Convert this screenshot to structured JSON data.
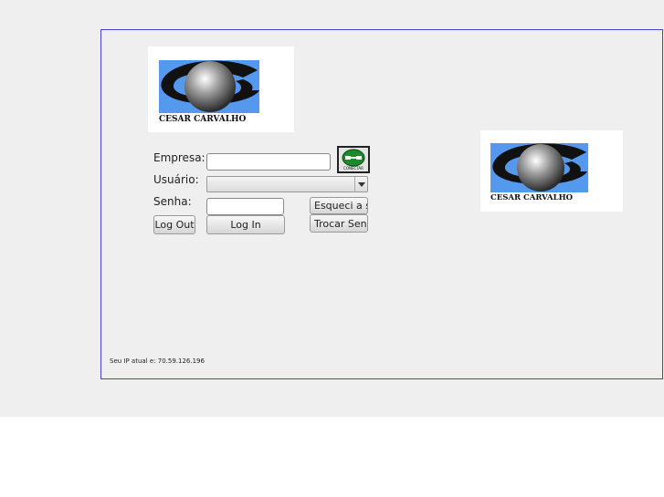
{
  "brand": {
    "name": "CESAR CARVALHO"
  },
  "form": {
    "empresa_label": "Empresa:",
    "usuario_label": "Usuário:",
    "senha_label": "Senha:",
    "empresa_value": "",
    "senha_value": "",
    "usuario_selected": "",
    "conectar_label": "CONECTAR"
  },
  "buttons": {
    "logout": "Log Out",
    "login": "Log In",
    "forgot": "Esqueci a senha",
    "change": "Trocar Senha"
  },
  "footer": {
    "ip_text": "Seu IP atual e: 70.59.126.196"
  },
  "colors": {
    "panel_border": "#4444cc",
    "logo_blue": "#5599ee"
  }
}
